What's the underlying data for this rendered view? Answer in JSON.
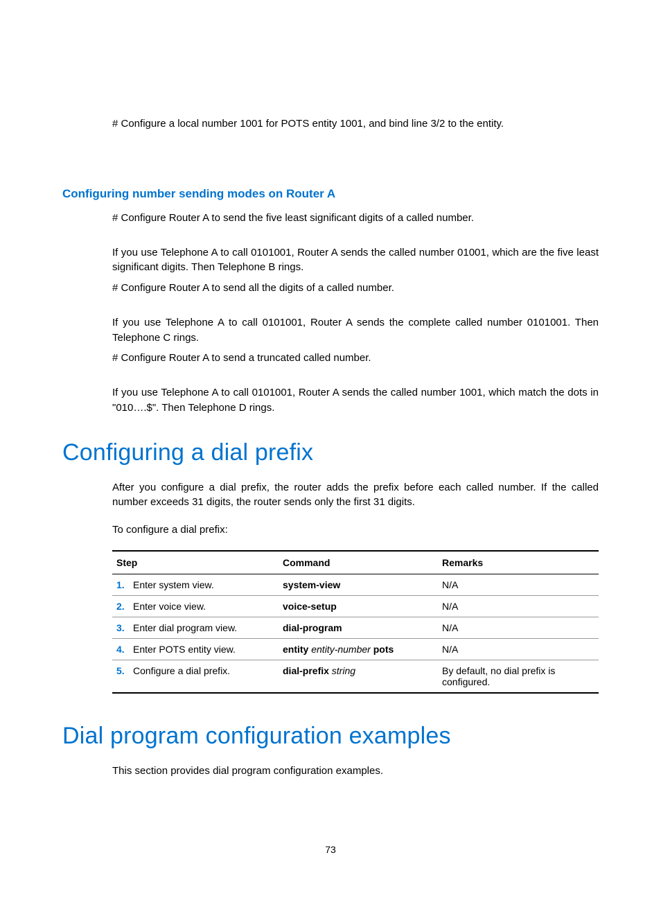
{
  "intro_para": "# Configure a local number 1001 for POTS entity 1001, and bind line 3/2 to the entity.",
  "section1": {
    "heading": "Configuring number sending modes on Router A",
    "p1": "# Configure Router A to send the five least significant digits of a called number.",
    "p2": "If you use Telephone A to call 0101001, Router A sends the called number 01001, which are the five least significant digits. Then Telephone B rings.",
    "p3": "# Configure Router A to send all the digits of a called number.",
    "p4": "If you use Telephone A to call 0101001, Router A sends the complete called number 0101001. Then Telephone C rings.",
    "p5": "# Configure Router A to send a truncated called number.",
    "p6": "If you use Telephone A to call 0101001, Router A sends the called number 1001, which match the dots in \"010….$\". Then Telephone D rings."
  },
  "section2": {
    "heading": "Configuring a dial prefix",
    "intro1": "After you configure a dial prefix, the router adds the prefix before each called number. If the called number exceeds 31 digits, the router sends only the first 31 digits.",
    "intro2": "To configure a dial prefix:",
    "table": {
      "headers": {
        "step": "Step",
        "command": "Command",
        "remarks": "Remarks"
      },
      "rows": [
        {
          "n": "1.",
          "step": "Enter system view.",
          "cmd_bold": "system-view",
          "cmd_italic": "",
          "cmd_suffix": "",
          "remarks": "N/A"
        },
        {
          "n": "2.",
          "step": "Enter voice view.",
          "cmd_bold": "voice-setup",
          "cmd_italic": "",
          "cmd_suffix": "",
          "remarks": "N/A"
        },
        {
          "n": "3.",
          "step": "Enter dial program view.",
          "cmd_bold": "dial-program",
          "cmd_italic": "",
          "cmd_suffix": "",
          "remarks": "N/A"
        },
        {
          "n": "4.",
          "step": "Enter POTS entity view.",
          "cmd_bold": "entity",
          "cmd_italic": " entity-number ",
          "cmd_suffix": "pots",
          "remarks": "N/A"
        },
        {
          "n": "5.",
          "step": "Configure a dial prefix.",
          "cmd_bold": "dial-prefix",
          "cmd_italic": " string",
          "cmd_suffix": "",
          "remarks": "By default, no dial prefix is configured."
        }
      ]
    }
  },
  "section3": {
    "heading": "Dial program configuration examples",
    "p1": "This section provides dial program configuration examples."
  },
  "page_number": "73"
}
